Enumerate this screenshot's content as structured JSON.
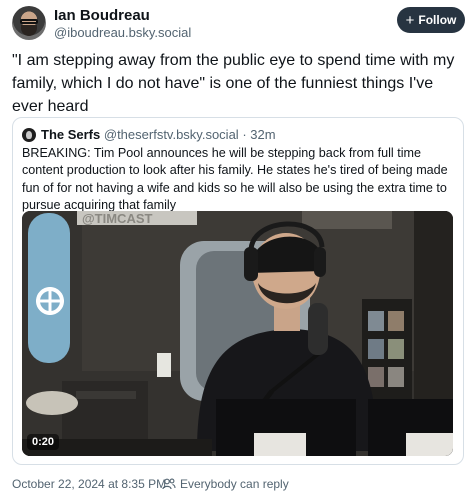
{
  "post": {
    "author": {
      "name": "Ian Boudreau",
      "handle": "@iboudreau.bsky.social"
    },
    "follow_label": "Follow",
    "text": "\"I am stepping away from the public eye to spend time with my family, which I do not have\" is one of the funniest things I've ever heard",
    "timestamp": "October 22, 2024 at 8:35 PM",
    "audience": "Everybody can reply"
  },
  "quote": {
    "author": {
      "name": "The Serfs",
      "handle": "@theserfstv.bsky.social"
    },
    "separator": "·",
    "time": "32m",
    "text": "BREAKING: Tim Pool announces he will be stepping back from full time content production to look after his family. He states he's tired of being made fun of for not having a wife and kids so he will also be using the extra time to pursue acquiring that family",
    "video": {
      "duration": "0:20",
      "banner_text": "@TIMCAST"
    }
  },
  "icons": {
    "follow": "plus-icon",
    "audience": "people-icon"
  },
  "colors": {
    "follow_bg": "#273441",
    "secondary_text": "#536471",
    "border": "#d7dfe6"
  }
}
